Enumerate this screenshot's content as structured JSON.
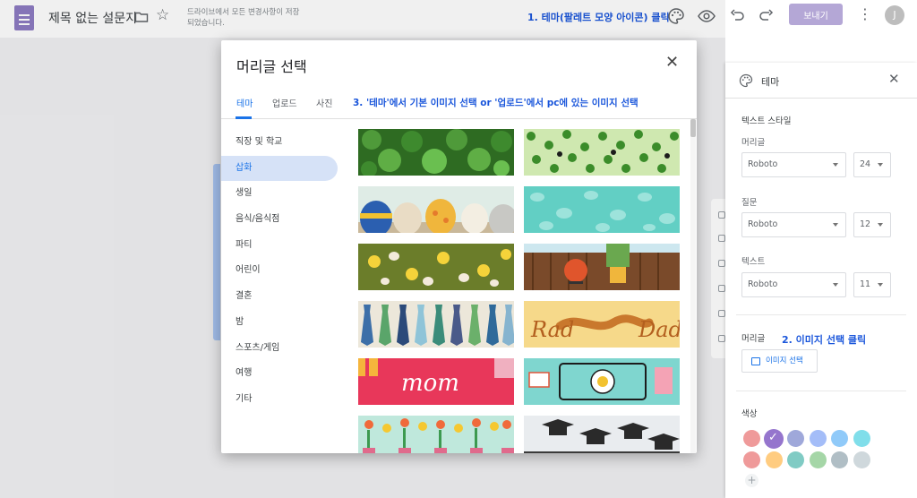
{
  "header": {
    "doc_title": "제목 없는 설문지",
    "save_status": "드라이브에서 모든 변경사항이 저장되었습니다.",
    "send_label": "보내기",
    "avatar_letter": "J",
    "icons": [
      "forms-doc-icon",
      "folder-icon",
      "star-icon",
      "palette-icon",
      "eye-icon",
      "undo-icon",
      "redo-icon",
      "more-vert-icon"
    ]
  },
  "annotations": {
    "step1": "1. 테마(팔레트 모양 아이콘) 클릭",
    "step2": "2. 이미지 선택 클릭",
    "step3": "3. '테마'에서 기본 이미지 선택 or '업로드'에서 pc에 있는 이미지 선택"
  },
  "modal": {
    "title": "머리글 선택",
    "tabs": [
      {
        "label": "테마",
        "active": true
      },
      {
        "label": "업로드",
        "active": false
      },
      {
        "label": "사진",
        "active": false
      }
    ],
    "categories": [
      {
        "label": "직장 및 학교",
        "active": false
      },
      {
        "label": "삽화",
        "active": true
      },
      {
        "label": "생일",
        "active": false
      },
      {
        "label": "음식/음식점",
        "active": false
      },
      {
        "label": "파티",
        "active": false
      },
      {
        "label": "어린이",
        "active": false
      },
      {
        "label": "결혼",
        "active": false
      },
      {
        "label": "밤",
        "active": false
      },
      {
        "label": "스포츠/게임",
        "active": false
      },
      {
        "label": "여행",
        "active": false
      },
      {
        "label": "기타",
        "active": false
      }
    ],
    "thumb_texts": {
      "rad_left": "Rad",
      "rad_right": "Dad",
      "mom": "mom"
    }
  },
  "theme_panel": {
    "title": "테마",
    "text_style_label": "텍스트 스타일",
    "header_label": "머리글",
    "question_label": "질문",
    "text_label": "텍스트",
    "header_font": "Roboto",
    "header_size": "24",
    "question_font": "Roboto",
    "question_size": "12",
    "text_font": "Roboto",
    "text_size": "11",
    "image_section_label": "머리글",
    "image_button": "이미지 선택",
    "color_label": "색상",
    "colors_row1": [
      "#ef9a9a",
      "#9575cd",
      "#9fa8da",
      "#a4bdf8",
      "#90caf9",
      "#80deea"
    ],
    "colors_row2": [
      "#ef9a9a",
      "#ffcc80",
      "#80cbc4",
      "#a5d6a7",
      "#b0bec5",
      "#cfd8dc"
    ],
    "selected_color": "#9575cd"
  }
}
